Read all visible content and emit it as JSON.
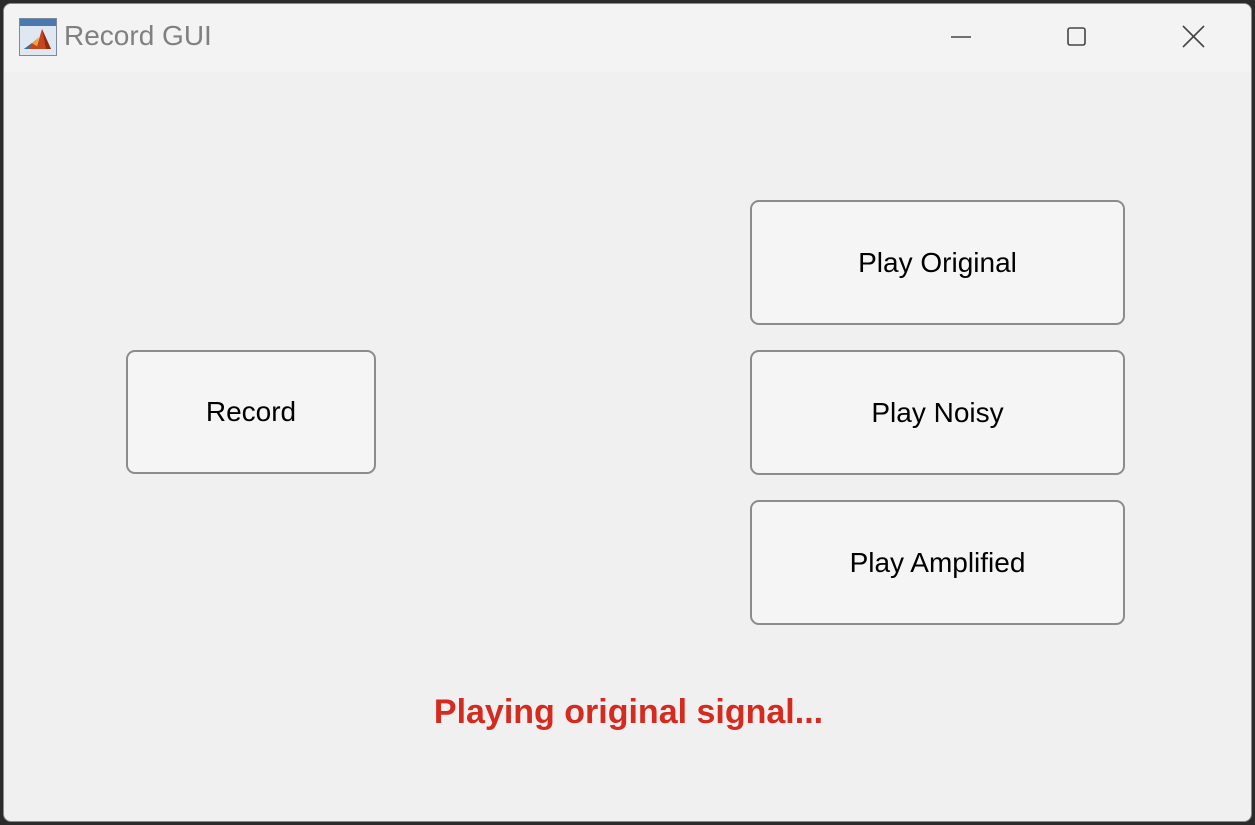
{
  "window": {
    "title": "Record GUI",
    "app_icon": "matlab-logo-icon",
    "controls": {
      "minimize_icon": "minimize-icon",
      "maximize_icon": "maximize-icon",
      "close_icon": "close-icon"
    }
  },
  "buttons": {
    "record": "Record",
    "play_original": "Play Original",
    "play_noisy": "Play Noisy",
    "play_amplified": "Play Amplified"
  },
  "status": {
    "text": "Playing original signal...",
    "color": "#d42a20"
  }
}
